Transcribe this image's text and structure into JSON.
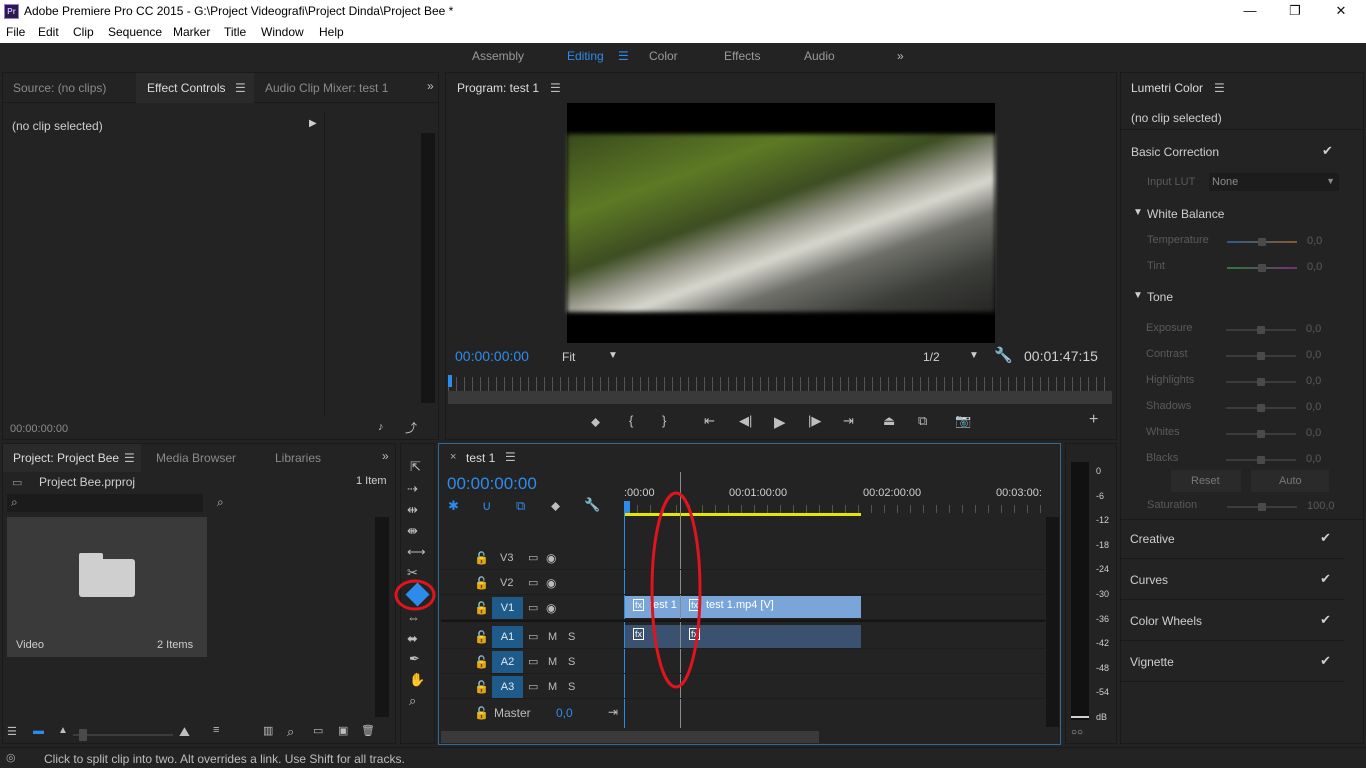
{
  "window": {
    "title": "Adobe Premiere Pro CC 2015 - G:\\Project Videografi\\Project Dinda\\Project Bee *",
    "logo": "Pr"
  },
  "menu": [
    "File",
    "Edit",
    "Clip",
    "Sequence",
    "Marker",
    "Title",
    "Window",
    "Help"
  ],
  "workspaces": {
    "items": [
      "Assembly",
      "Editing",
      "Color",
      "Effects",
      "Audio"
    ],
    "active": "Editing",
    "overflow": "»"
  },
  "source_panel": {
    "tabs": [
      "Source: (no clips)",
      "Effect Controls",
      "Audio Clip Mixer: test 1"
    ],
    "no_clip": "(no clip selected)",
    "timecode": "00:00:00:00"
  },
  "program_panel": {
    "title": "Program: test 1",
    "timecode": "00:00:00:00",
    "fit": "Fit",
    "resolution": "1/2",
    "duration": "00:01:47:15"
  },
  "lumetri": {
    "title": "Lumetri Color",
    "no_clip": "(no clip selected)",
    "basic": "Basic Correction",
    "input_lut_label": "Input LUT",
    "input_lut_value": "None",
    "white_balance": "White Balance",
    "temperature": "Temperature",
    "tint": "Tint",
    "tone": "Tone",
    "tone_rows": [
      "Exposure",
      "Contrast",
      "Highlights",
      "Shadows",
      "Whites",
      "Blacks"
    ],
    "zero": "0,0",
    "reset": "Reset",
    "auto": "Auto",
    "saturation": "Saturation",
    "saturation_value": "100,0",
    "sections": [
      "Creative",
      "Curves",
      "Color Wheels",
      "Vignette"
    ]
  },
  "project_panel": {
    "tabs": [
      "Project: Project Bee",
      "Media Browser",
      "Libraries"
    ],
    "filename": "Project Bee.prproj",
    "count": "1 Item",
    "bin_name": "Video",
    "bin_items": "2 Items"
  },
  "timeline": {
    "tab": "test 1",
    "timecode": "00:00:00:00",
    "ruler": [
      ":00:00",
      "00:01:00:00",
      "00:02:00:00",
      "00:03:00:"
    ],
    "tracks_v": [
      "V3",
      "V2",
      "V1"
    ],
    "tracks_a": [
      "A1",
      "A2",
      "A3"
    ],
    "master": "Master",
    "master_value": "0,0",
    "clip_a": "test 1",
    "clip_b": "test 1.mp4 [V]",
    "toggle_m": "M",
    "toggle_s": "S"
  },
  "meter": {
    "scale": [
      "0",
      "-6",
      "-12",
      "-18",
      "-24",
      "-30",
      "-36",
      "-42",
      "-48",
      "-54",
      "dB"
    ]
  },
  "status": {
    "text": "Click to split clip into two. Alt overrides a link. Use Shift for all tracks."
  },
  "colors": {
    "accent": "#2d8ceb",
    "clip_video": "#7aa5d9",
    "clip_audio": "#3a5270",
    "track_label": "#1f5b8a",
    "highlight_circle": "#e0141e"
  }
}
